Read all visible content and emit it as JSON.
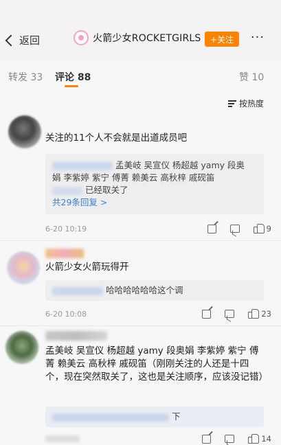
{
  "header": {
    "back_label": "返回",
    "brand_name": "火箭少女ROCKETGIRLS",
    "follow_label": "+关注",
    "more_label": "···"
  },
  "tabs": [
    {
      "label": "转发",
      "count": "33"
    },
    {
      "label": "评论",
      "count": "88"
    },
    {
      "label": "赞",
      "count": "10"
    }
  ],
  "sort_label": "按热度",
  "comments": [
    {
      "text": "关注的11个人不会就是出道成员吧",
      "reply_lines": [
        "孟美岐 吴宣仪 杨超越 yamy 段奥",
        "娟 李紫婷 紫宁 傅菁 赖美云 高秋梓 戚砚笛",
        "已经取关了"
      ],
      "reply_more": "共29条回复 >",
      "time": "6-20 10:19",
      "likes": "9"
    },
    {
      "text": "火箭少女火箭玩得开",
      "reply_lines": [
        "哈哈哈哈哈哈这个调"
      ],
      "time": "6-20 10:08",
      "likes": "23"
    },
    {
      "text": "孟美岐 吴宣仪 杨超越 yamy 段奥娟 李紫婷 紫宁 傅菁 赖美云 高秋梓 戚砚笛（刚刚关注的人还是十四个，现在突然取关了，这也是关注顺序，应该没记错）",
      "reply_lines": [
        "下"
      ],
      "likes": "14"
    }
  ],
  "colors": {
    "accent": "#ff8200",
    "link": "#3b7ed9"
  }
}
